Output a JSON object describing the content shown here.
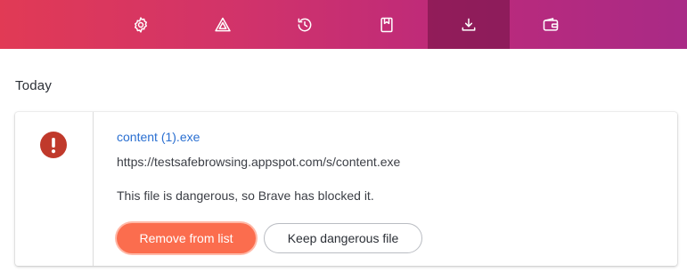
{
  "toolbar": {
    "items": [
      {
        "icon": "gear-icon",
        "label": "Settings"
      },
      {
        "icon": "brave-rewards-icon",
        "label": "Rewards"
      },
      {
        "icon": "history-icon",
        "label": "History"
      },
      {
        "icon": "bookmarks-icon",
        "label": "Bookmarks"
      },
      {
        "icon": "download-icon",
        "label": "Downloads",
        "active": true
      },
      {
        "icon": "wallet-icon",
        "label": "Wallet"
      }
    ]
  },
  "downloads": {
    "section_title": "Today",
    "item": {
      "file_name": "content (1).exe",
      "url": "https://testsafebrowsing.appspot.com/s/content.exe",
      "status": "This file is dangerous, so Brave has blocked it.",
      "remove_label": "Remove from list",
      "keep_label": "Keep dangerous file"
    }
  },
  "colors": {
    "accent_link": "#2a6fd1",
    "danger": "#c0392b",
    "remove_button": "#fb6d4e"
  }
}
